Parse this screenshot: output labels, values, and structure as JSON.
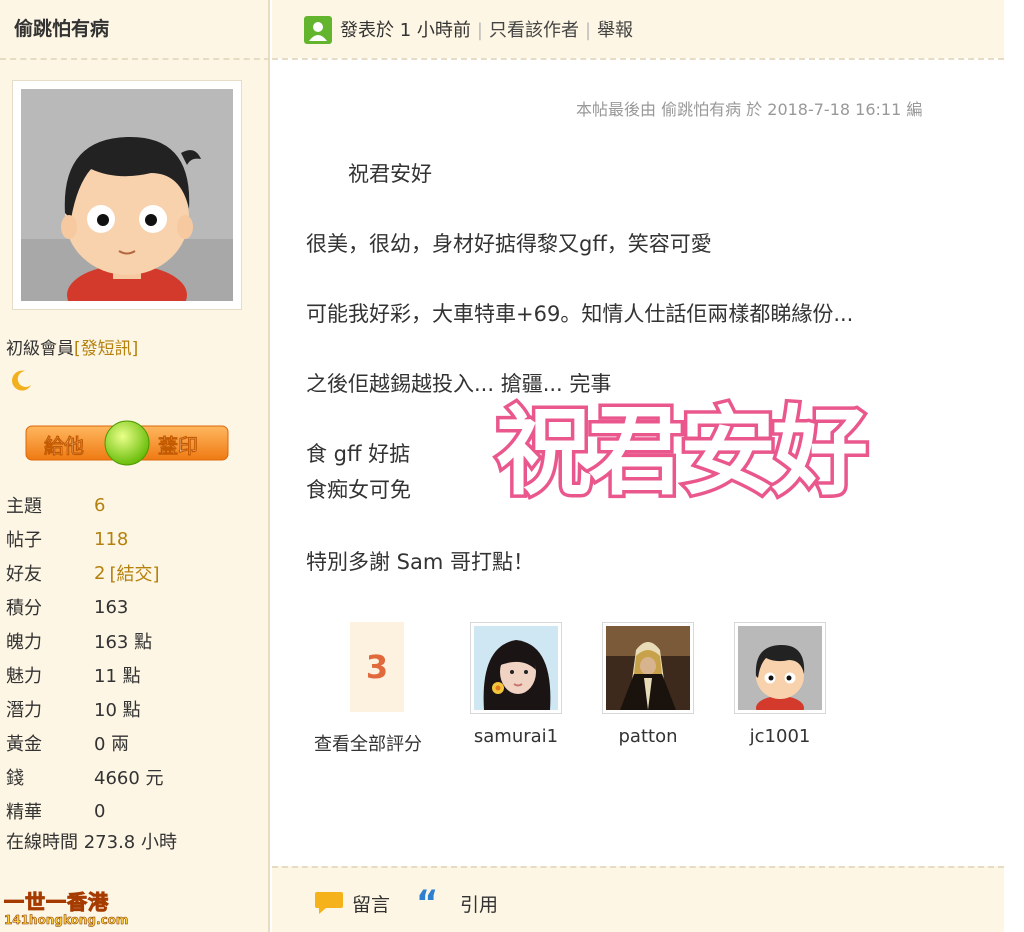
{
  "sidebar": {
    "username": "偷跳怕有病",
    "rank": "初級會員",
    "send_pm_label": "[發短訊]",
    "stamp_button": {
      "left": "給他",
      "right": "蓋印"
    },
    "stats": [
      {
        "label": "主題",
        "value": "6",
        "link": true
      },
      {
        "label": "帖子",
        "value": "118",
        "link": true
      },
      {
        "label": "好友",
        "value": "2",
        "extra": "[結交]",
        "link": true
      },
      {
        "label": "積分",
        "value": "163"
      },
      {
        "label": "魄力",
        "value": "163 點"
      },
      {
        "label": "魅力",
        "value": "11 點"
      },
      {
        "label": "潛力",
        "value": "10 點"
      },
      {
        "label": "黃金",
        "value": "0 兩"
      },
      {
        "label": "錢",
        "value": "4660 元"
      },
      {
        "label": "精華",
        "value": "0"
      }
    ],
    "online_time": "在線時間 273.8 小時",
    "logo": {
      "zh": "一世一香港",
      "en": "141hongkong.com"
    }
  },
  "post": {
    "header": {
      "posted": "發表於 1 小時前",
      "view_author": "只看該作者",
      "report": "舉報"
    },
    "edit_note": "本帖最後由 偷跳怕有病 於 2018-7-18 16:11 編",
    "lines": [
      "祝君安好",
      "很美，很幼，身材好掂得黎又gff，笑容可愛",
      "可能我好彩，大車特車+69。知情人仕話佢兩樣都睇緣份...",
      "之後佢越錫越投入... 搶疆... 完事",
      "食 gff 好掂",
      "食痴女可免",
      "特別多謝 Sam 哥打點！"
    ],
    "stamp_text": "祝君安好",
    "rating": {
      "count": "3",
      "view_all": "查看全部評分",
      "raters": [
        "samurai1",
        "patton",
        "jc1001"
      ]
    },
    "footer": {
      "comment": "留言",
      "quote": "引用"
    }
  },
  "colors": {
    "accent_orange": "#b5810e",
    "stamp_pink": "#e9578d",
    "quote_blue": "#2f7fd1",
    "sidebar_bg": "#fdf6e4"
  }
}
